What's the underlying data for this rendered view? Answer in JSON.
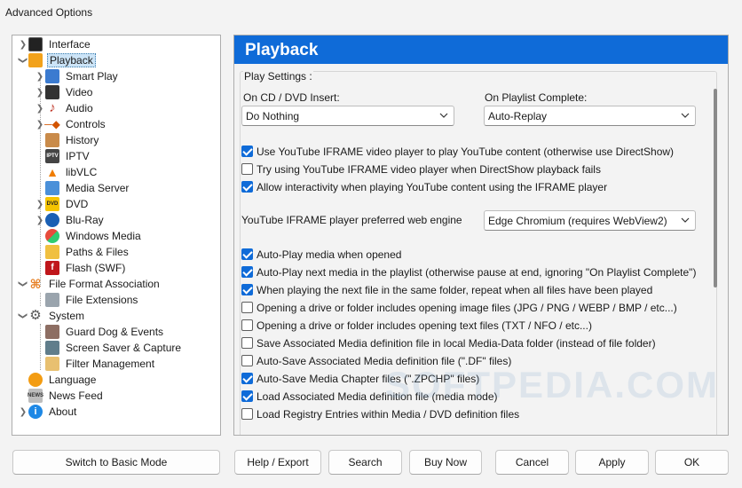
{
  "window": {
    "title": "Advanced Options"
  },
  "tree": {
    "items": [
      {
        "label": "Interface",
        "icon": "monitor-icon"
      },
      {
        "label": "Playback",
        "icon": "playback-icon",
        "selected": true
      },
      {
        "label": "Smart Play",
        "icon": "smart-play-icon"
      },
      {
        "label": "Video",
        "icon": "video-icon"
      },
      {
        "label": "Audio",
        "icon": "audio-note-icon"
      },
      {
        "label": "Controls",
        "icon": "controls-icon"
      },
      {
        "label": "History",
        "icon": "history-icon"
      },
      {
        "label": "IPTV",
        "icon": "iptv-icon"
      },
      {
        "label": "libVLC",
        "icon": "vlc-cone-icon"
      },
      {
        "label": "Media Server",
        "icon": "media-server-icon"
      },
      {
        "label": "DVD",
        "icon": "dvd-icon"
      },
      {
        "label": "Blu-Ray",
        "icon": "bluray-icon"
      },
      {
        "label": "Windows Media",
        "icon": "windows-media-icon"
      },
      {
        "label": "Paths & Files",
        "icon": "folder-icon"
      },
      {
        "label": "Flash (SWF)",
        "icon": "flash-icon"
      },
      {
        "label": "File Format Association",
        "icon": "file-format-icon"
      },
      {
        "label": "File Extensions",
        "icon": "file-extensions-icon"
      },
      {
        "label": "System",
        "icon": "gear-icon"
      },
      {
        "label": "Guard Dog & Events",
        "icon": "guard-dog-icon"
      },
      {
        "label": "Screen Saver & Capture",
        "icon": "screen-capture-icon"
      },
      {
        "label": "Filter Management",
        "icon": "filter-icon"
      },
      {
        "label": "Language",
        "icon": "language-icon"
      },
      {
        "label": "News Feed",
        "icon": "news-icon"
      },
      {
        "label": "About",
        "icon": "info-icon"
      }
    ]
  },
  "panel": {
    "title": "Playback",
    "group_label": "Play Settings :",
    "cd_label": "On CD / DVD Insert:",
    "cd_value": "Do Nothing",
    "playlist_label": "On Playlist Complete:",
    "playlist_value": "Auto-Replay",
    "engine_label": "YouTube IFRAME player preferred web engine",
    "engine_value": "Edge Chromium (requires WebView2)",
    "checks_a": [
      {
        "label": "Use YouTube IFRAME video player to play YouTube content (otherwise use DirectShow)",
        "checked": true
      },
      {
        "label": "Try using YouTube IFRAME video player when DirectShow playback fails",
        "checked": false
      },
      {
        "label": "Allow interactivity when playing YouTube content using the IFRAME player",
        "checked": true
      }
    ],
    "checks_b": [
      {
        "label": "Auto-Play media when opened",
        "checked": true
      },
      {
        "label": "Auto-Play next media in the playlist (otherwise pause at end, ignoring \"On Playlist Complete\")",
        "checked": true
      },
      {
        "label": "When playing the next file in the same folder, repeat when all files have been played",
        "checked": true
      },
      {
        "label": "Opening a drive or folder includes opening image files (JPG / PNG / WEBP / BMP / etc...)",
        "checked": false
      },
      {
        "label": "Opening a drive or folder includes opening text files (TXT / NFO / etc...)",
        "checked": false
      },
      {
        "label": "Save Associated Media definition file in local Media-Data folder (instead of file folder)",
        "checked": false
      },
      {
        "label": "Auto-Save Associated Media definition file (\".DF\" files)",
        "checked": false
      },
      {
        "label": "Auto-Save Media Chapter files (\".ZPCHP\" files)",
        "checked": true
      },
      {
        "label": "Load Associated Media definition file (media mode)",
        "checked": true
      },
      {
        "label": "Load Registry Entries within Media / DVD definition files",
        "checked": false
      }
    ],
    "watermark": "SOFTPEDIA.COM"
  },
  "buttons": {
    "basic_mode": "Switch to Basic Mode",
    "help": "Help / Export",
    "search": "Search",
    "buy": "Buy Now",
    "cancel": "Cancel",
    "apply": "Apply",
    "ok": "OK"
  },
  "colors": {
    "accent": "#0f6bd8",
    "header_text": "#ffffff"
  }
}
